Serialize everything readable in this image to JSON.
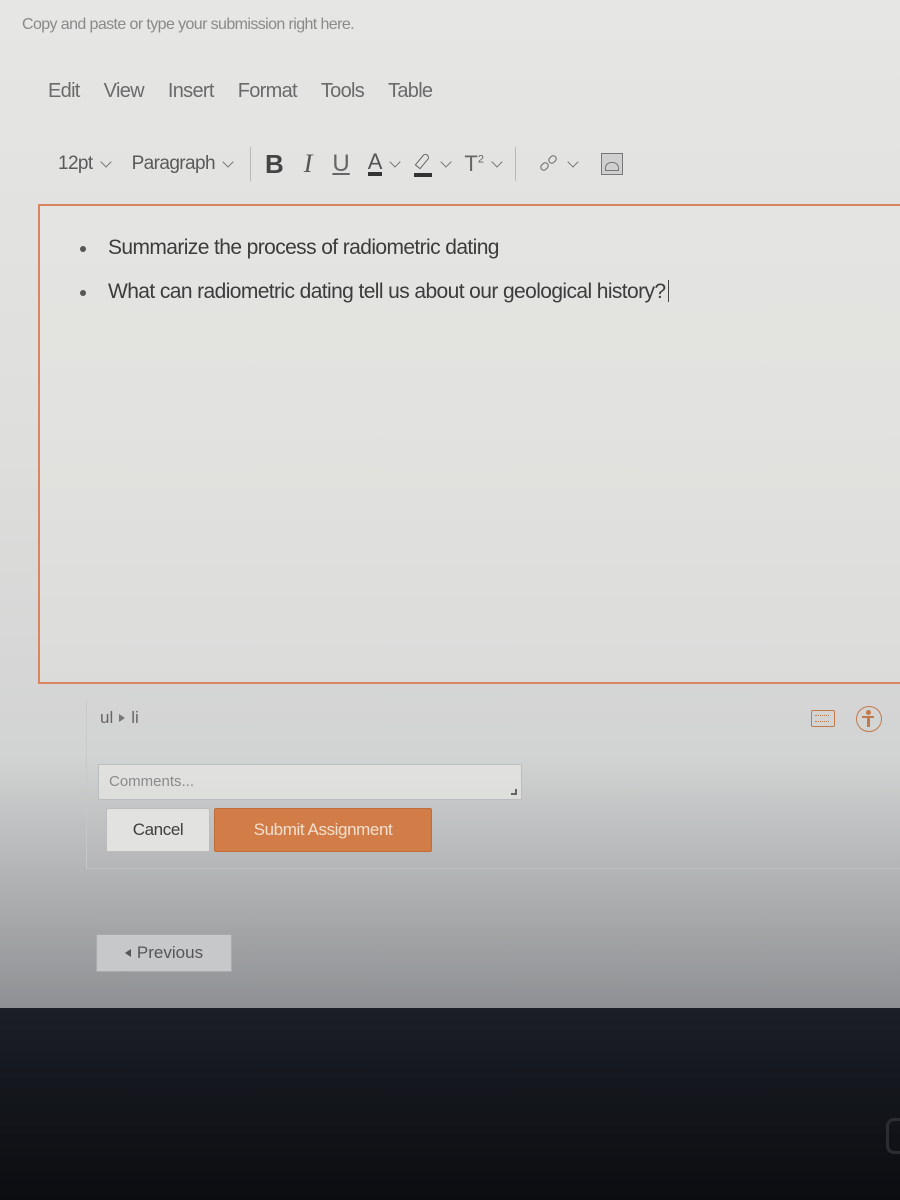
{
  "instruction": "Copy and paste or type your submission right here.",
  "menubar": {
    "items": [
      {
        "label": "Edit"
      },
      {
        "label": "View"
      },
      {
        "label": "Insert"
      },
      {
        "label": "Format"
      },
      {
        "label": "Tools"
      },
      {
        "label": "Table"
      }
    ]
  },
  "toolbar": {
    "font_size": "12pt",
    "block_format": "Paragraph",
    "bold_label": "B",
    "italic_label": "I",
    "underline_label": "U",
    "font_color_label": "A",
    "superscript_label": "T",
    "superscript_sup": "2",
    "icons": [
      "bold-icon",
      "italic-icon",
      "underline-icon",
      "font-color-icon",
      "highlight-icon",
      "superscript-icon",
      "link-icon",
      "image-icon"
    ]
  },
  "editor": {
    "bullets": [
      "Summarize the process of radiometric dating",
      "What can radiometric dating tell us about our geological history?"
    ],
    "focus_color": "#d9855f"
  },
  "statusbar": {
    "path": [
      "ul",
      "li"
    ],
    "icons": [
      "keyboard-shortcuts-icon",
      "accessibility-checker-icon"
    ]
  },
  "comments": {
    "placeholder": "Comments..."
  },
  "actions": {
    "cancel_label": "Cancel",
    "submit_label": "Submit Assignment",
    "submit_color": "#d27d47"
  },
  "navigation": {
    "previous_label": "Previous"
  }
}
